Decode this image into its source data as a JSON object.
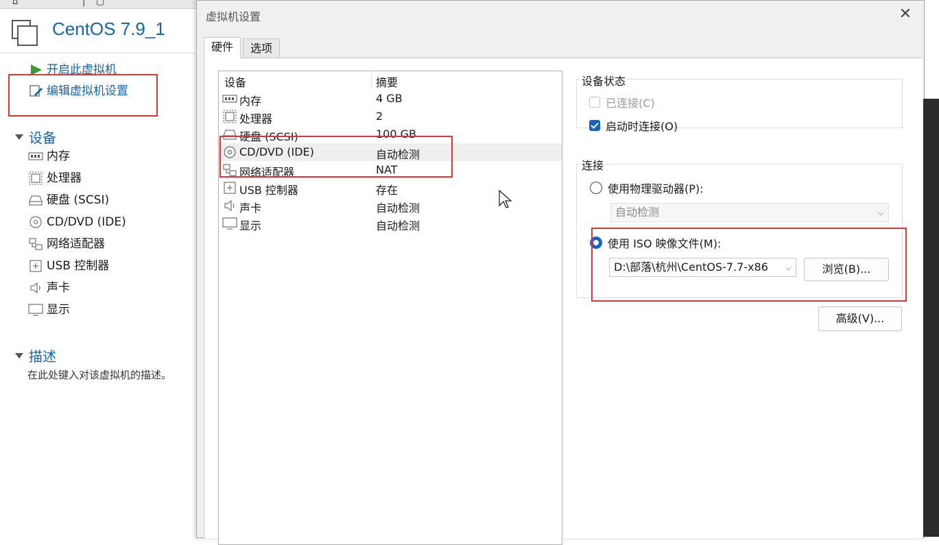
{
  "left": {
    "vm_title": "CentOS 7.9_1",
    "actions": [
      {
        "label": "开启此虚拟机",
        "icon": "play-icon"
      },
      {
        "label": "编辑虚拟机设置",
        "icon": "edit-settings-icon"
      }
    ],
    "devices_header": "设备",
    "devices": [
      {
        "label": "内存",
        "icon": "memory-icon"
      },
      {
        "label": "处理器",
        "icon": "processor-icon"
      },
      {
        "label": "硬盘 (SCSI)",
        "icon": "hard-disk-icon"
      },
      {
        "label": "CD/DVD (IDE)",
        "icon": "cd-dvd-icon"
      },
      {
        "label": "网络适配器",
        "icon": "network-adapter-icon"
      },
      {
        "label": "USB 控制器",
        "icon": "usb-icon"
      },
      {
        "label": "声卡",
        "icon": "sound-icon"
      },
      {
        "label": "显示",
        "icon": "display-icon"
      }
    ],
    "description_header": "描述",
    "description_text": "在此处键入对该虚拟机的描述。"
  },
  "dialog": {
    "title": "虚拟机设置",
    "tabs": [
      "硬件",
      "选项"
    ],
    "device_list": {
      "col_device": "设备",
      "col_summary": "摘要",
      "rows": [
        {
          "name": "内存",
          "summary": "4 GB",
          "icon": "memory-icon"
        },
        {
          "name": "处理器",
          "summary": "2",
          "icon": "processor-icon"
        },
        {
          "name": "硬盘 (SCSI)",
          "summary": "100 GB",
          "icon": "hard-disk-icon"
        },
        {
          "name": "CD/DVD (IDE)",
          "summary": "自动检测",
          "icon": "cd-dvd-icon"
        },
        {
          "name": "网络适配器",
          "summary": "NAT",
          "icon": "network-adapter-icon"
        },
        {
          "name": "USB 控制器",
          "summary": "存在",
          "icon": "usb-icon"
        },
        {
          "name": "声卡",
          "summary": "自动检测",
          "icon": "sound-icon"
        },
        {
          "name": "显示",
          "summary": "自动检测",
          "icon": "display-icon"
        }
      ]
    },
    "device_status": {
      "title": "设备状态",
      "connected_label": "已连接(C)",
      "connect_at_power_on_label": "启动时连接(O)"
    },
    "connection": {
      "title": "连接",
      "physical_drive_label": "使用物理驱动器(P):",
      "physical_drive_value": "自动检测",
      "iso_label": "使用 ISO 映像文件(M):",
      "iso_path": "D:\\部落\\杭州\\CentOS-7.7-x86",
      "browse_label": "浏览(B)..."
    },
    "advanced_label": "高级(V)..."
  },
  "colors": {
    "accent": "#1565c0",
    "link": "#1565a8",
    "highlight_box": "#e03535"
  }
}
